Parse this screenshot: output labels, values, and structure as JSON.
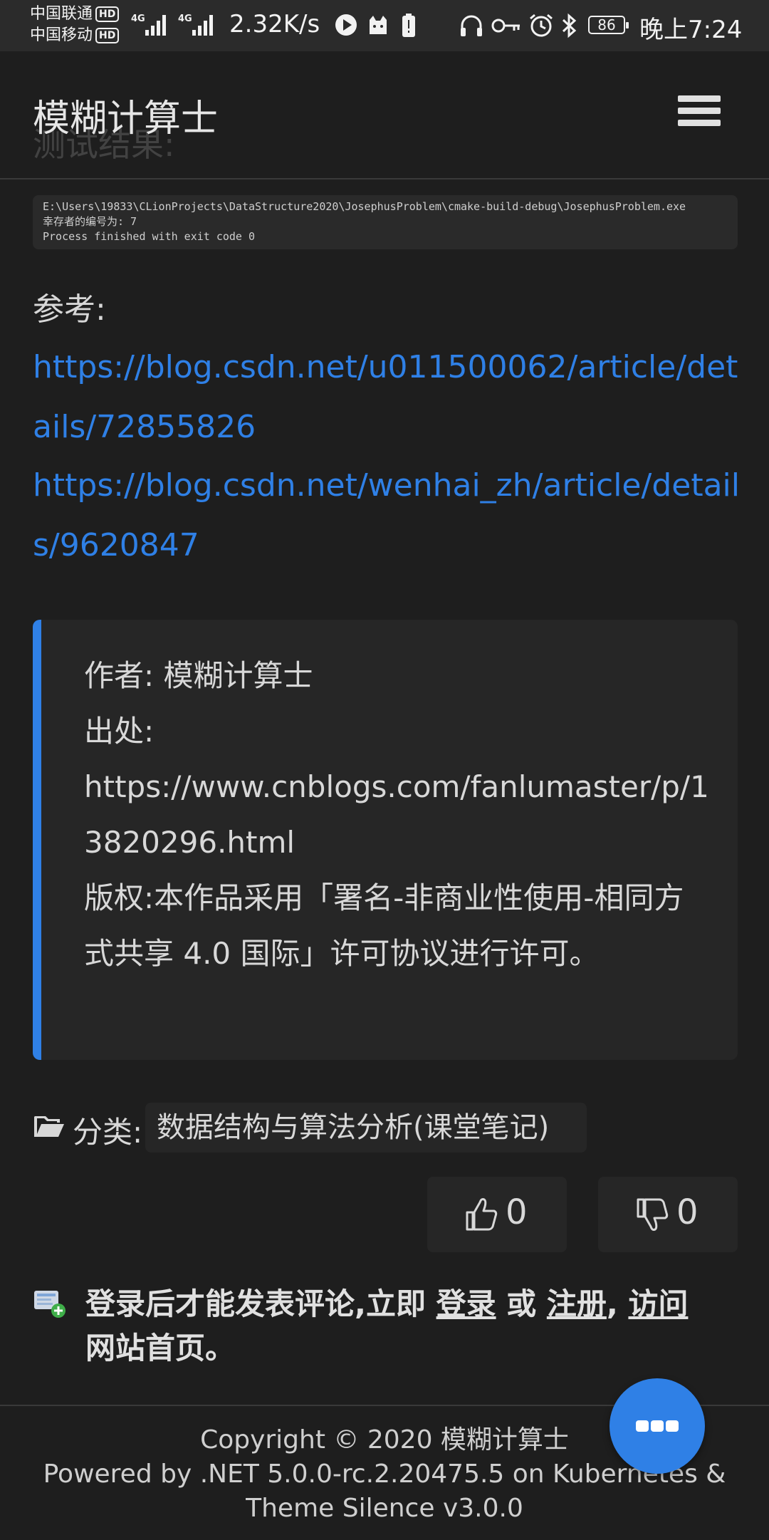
{
  "status_bar": {
    "carrier1": "中国联通",
    "carrier2": "中国移动",
    "hd": "HD",
    "net1": "4G",
    "net2": "4G",
    "net_speed": "2.32K/s",
    "battery": "86",
    "time": "晚上7:24"
  },
  "header": {
    "site_title": "模糊计算士",
    "ghost_heading": "测试结果:"
  },
  "code_output": {
    "line1": "E:\\Users\\19833\\CLionProjects\\DataStructure2020\\JosephusProblem\\cmake-build-debug\\JosephusProblem.exe",
    "line2": "幸存者的编号为: 7",
    "line3": "Process finished with exit code 0"
  },
  "references": {
    "label": "参考:",
    "links": [
      "https://blog.csdn.net/u011500062/article/details/72855826",
      "https://blog.csdn.net/wenhai_zh/article/details/9620847"
    ]
  },
  "copyright_box": {
    "author_label": "作者:",
    "author": "模糊计算士",
    "source_label": "出处:",
    "source_url": "https://www.cnblogs.com/fanlumaster/p/13820296.html",
    "license": "版权:本作品采用「署名-非商业性使用-相同方式共享 4.0 国际」许可协议进行许可。"
  },
  "category": {
    "label": "分类:",
    "tag": "数据结构与算法分析(课堂笔记)"
  },
  "votes": {
    "up_count": "0",
    "down_count": "0"
  },
  "comment": {
    "prefix": "登录后才能发表评论,立即 ",
    "login": "登录",
    "or": " 或 ",
    "register": "注册",
    "comma": ", ",
    "visit": "访问",
    "suffix": "网站首页。"
  },
  "footer": {
    "copyright": "Copyright © 2020 模糊计算士",
    "powered": "Powered by .NET 5.0.0-rc.2.20475.5 on Kubernetes & Theme Silence v3.0.0"
  },
  "colors": {
    "accent": "#2f80e6",
    "background": "#1e1e1e",
    "panel": "#262626"
  }
}
